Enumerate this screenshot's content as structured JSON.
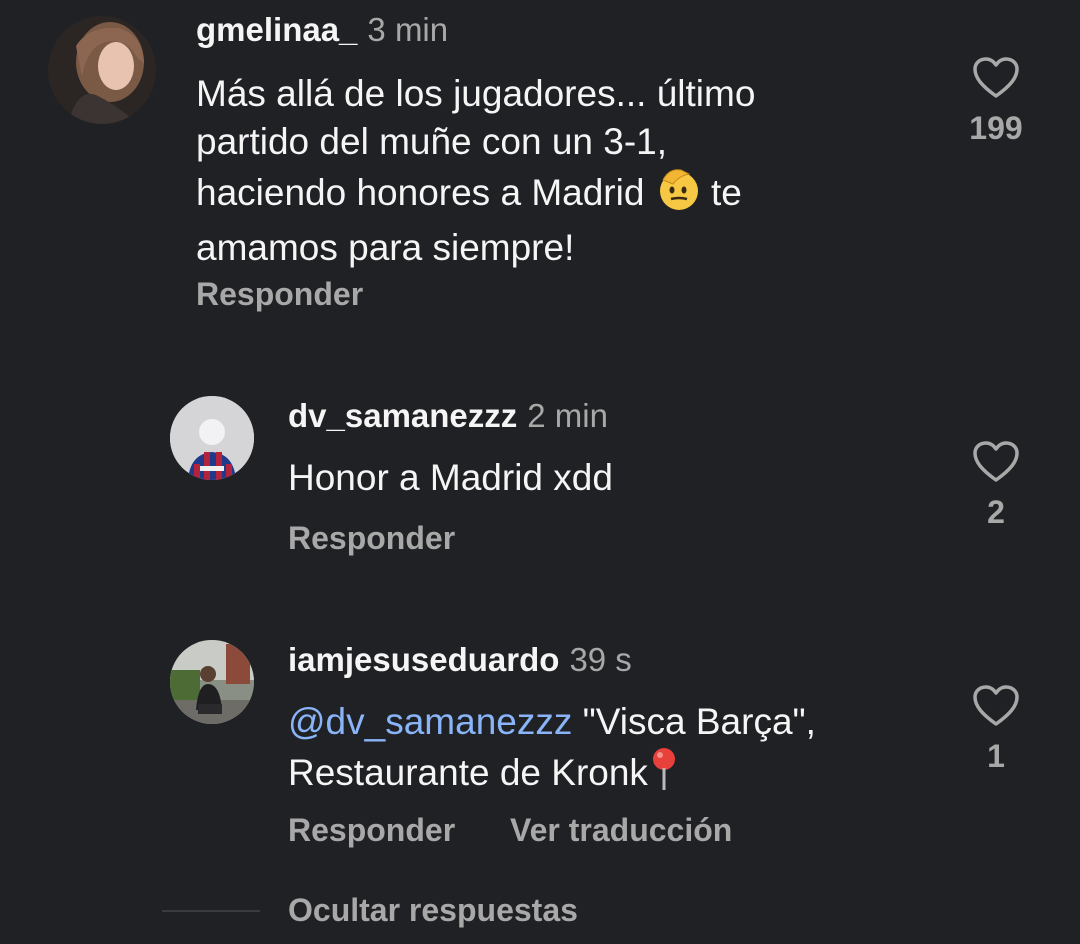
{
  "comments": [
    {
      "username": "gmelinaa_",
      "time": "3 min",
      "text_line1": "Más allá de los jugadores... último",
      "text_line2": "partido del muñe con un 3-1,",
      "text_line3a": "haciendo honores a Madrid",
      "text_line3b": "te",
      "text_line4": "amamos para siempre!",
      "reply_label": "Responder",
      "likes": "199"
    },
    {
      "username": "dv_samanezzz",
      "time": "2 min",
      "text": "Honor a Madrid xdd",
      "reply_label": "Responder",
      "likes": "2"
    },
    {
      "username": "iamjesuseduardo",
      "time": "39 s",
      "mention": "@dv_samanezzz",
      "text_line1": "\"Visca Barça\",",
      "text_line2": "Restaurante de Kronk",
      "reply_label": "Responder",
      "translate_label": "Ver traducción",
      "likes": "1"
    }
  ],
  "hide_replies_label": "Ocultar respuestas",
  "colors": {
    "background": "#202124",
    "text": "#f5f5f5",
    "muted": "#a8a8a8",
    "mention": "#8ab4f8"
  }
}
